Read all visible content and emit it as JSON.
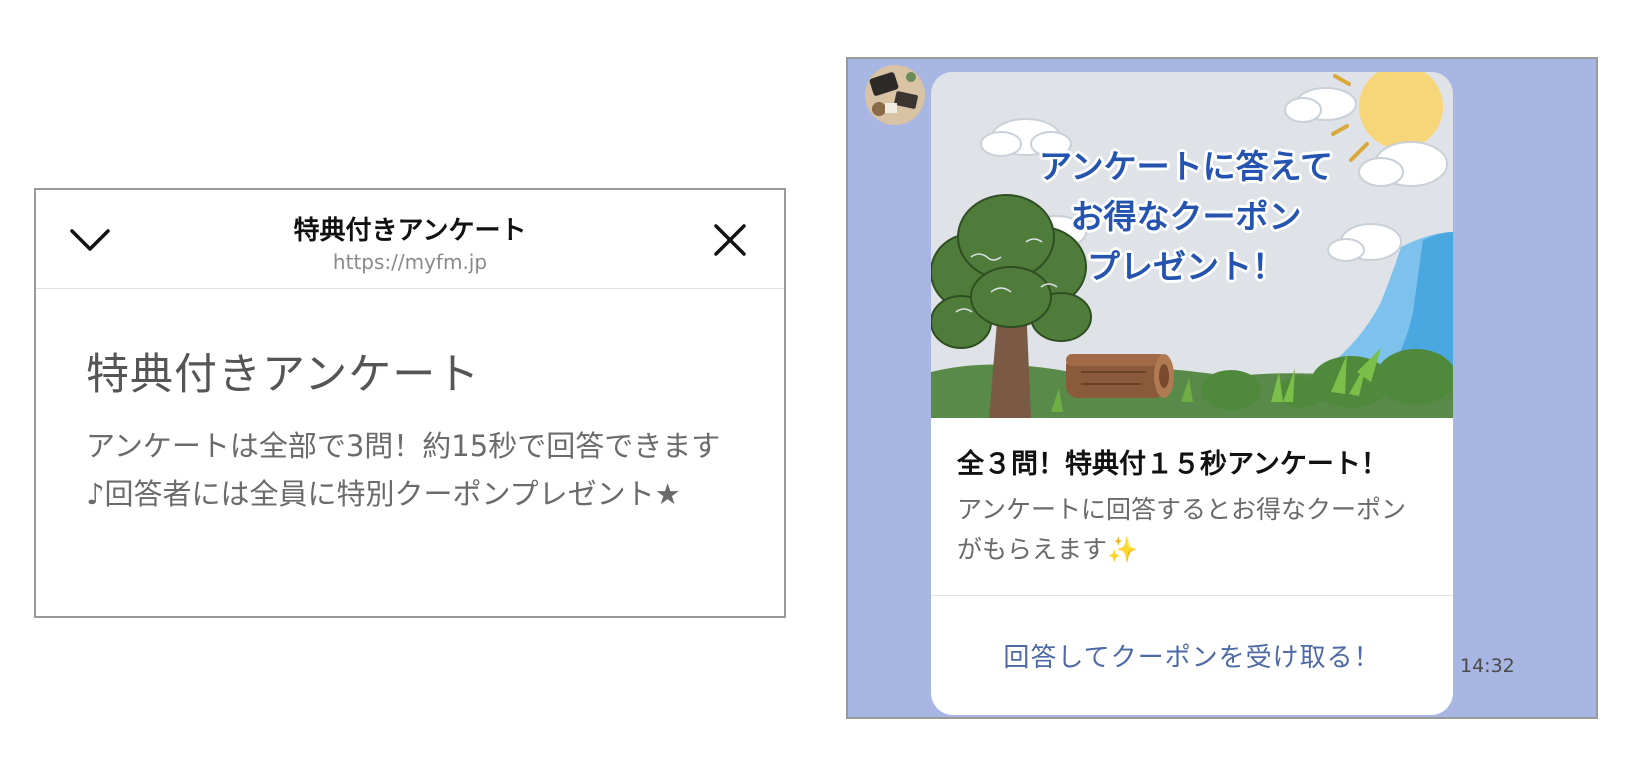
{
  "browser": {
    "collapse_icon": "chevron-down-icon",
    "close_icon": "close-icon",
    "title": "特典付きアンケート",
    "url": "https://myfm.jp",
    "page_heading": "特典付きアンケート",
    "page_description": "アンケートは全部で3問！約15秒で回答できます♪回答者には全員に特別クーポンプレゼント★"
  },
  "chat": {
    "background_color": "#a7b6e2",
    "avatar_icon": "avatar",
    "message": {
      "hero_text_lines": [
        "アンケートに答えて",
        "お得なクーポン",
        "プレゼント！"
      ],
      "title": "全３問！特典付１５秒アンケート！",
      "description": "アンケートに回答するとお得なクーポンがもらえます✨",
      "action_label": "回答してクーポンを受け取る！",
      "action_color": "#4e6aa6"
    },
    "timestamp": "14:32"
  }
}
